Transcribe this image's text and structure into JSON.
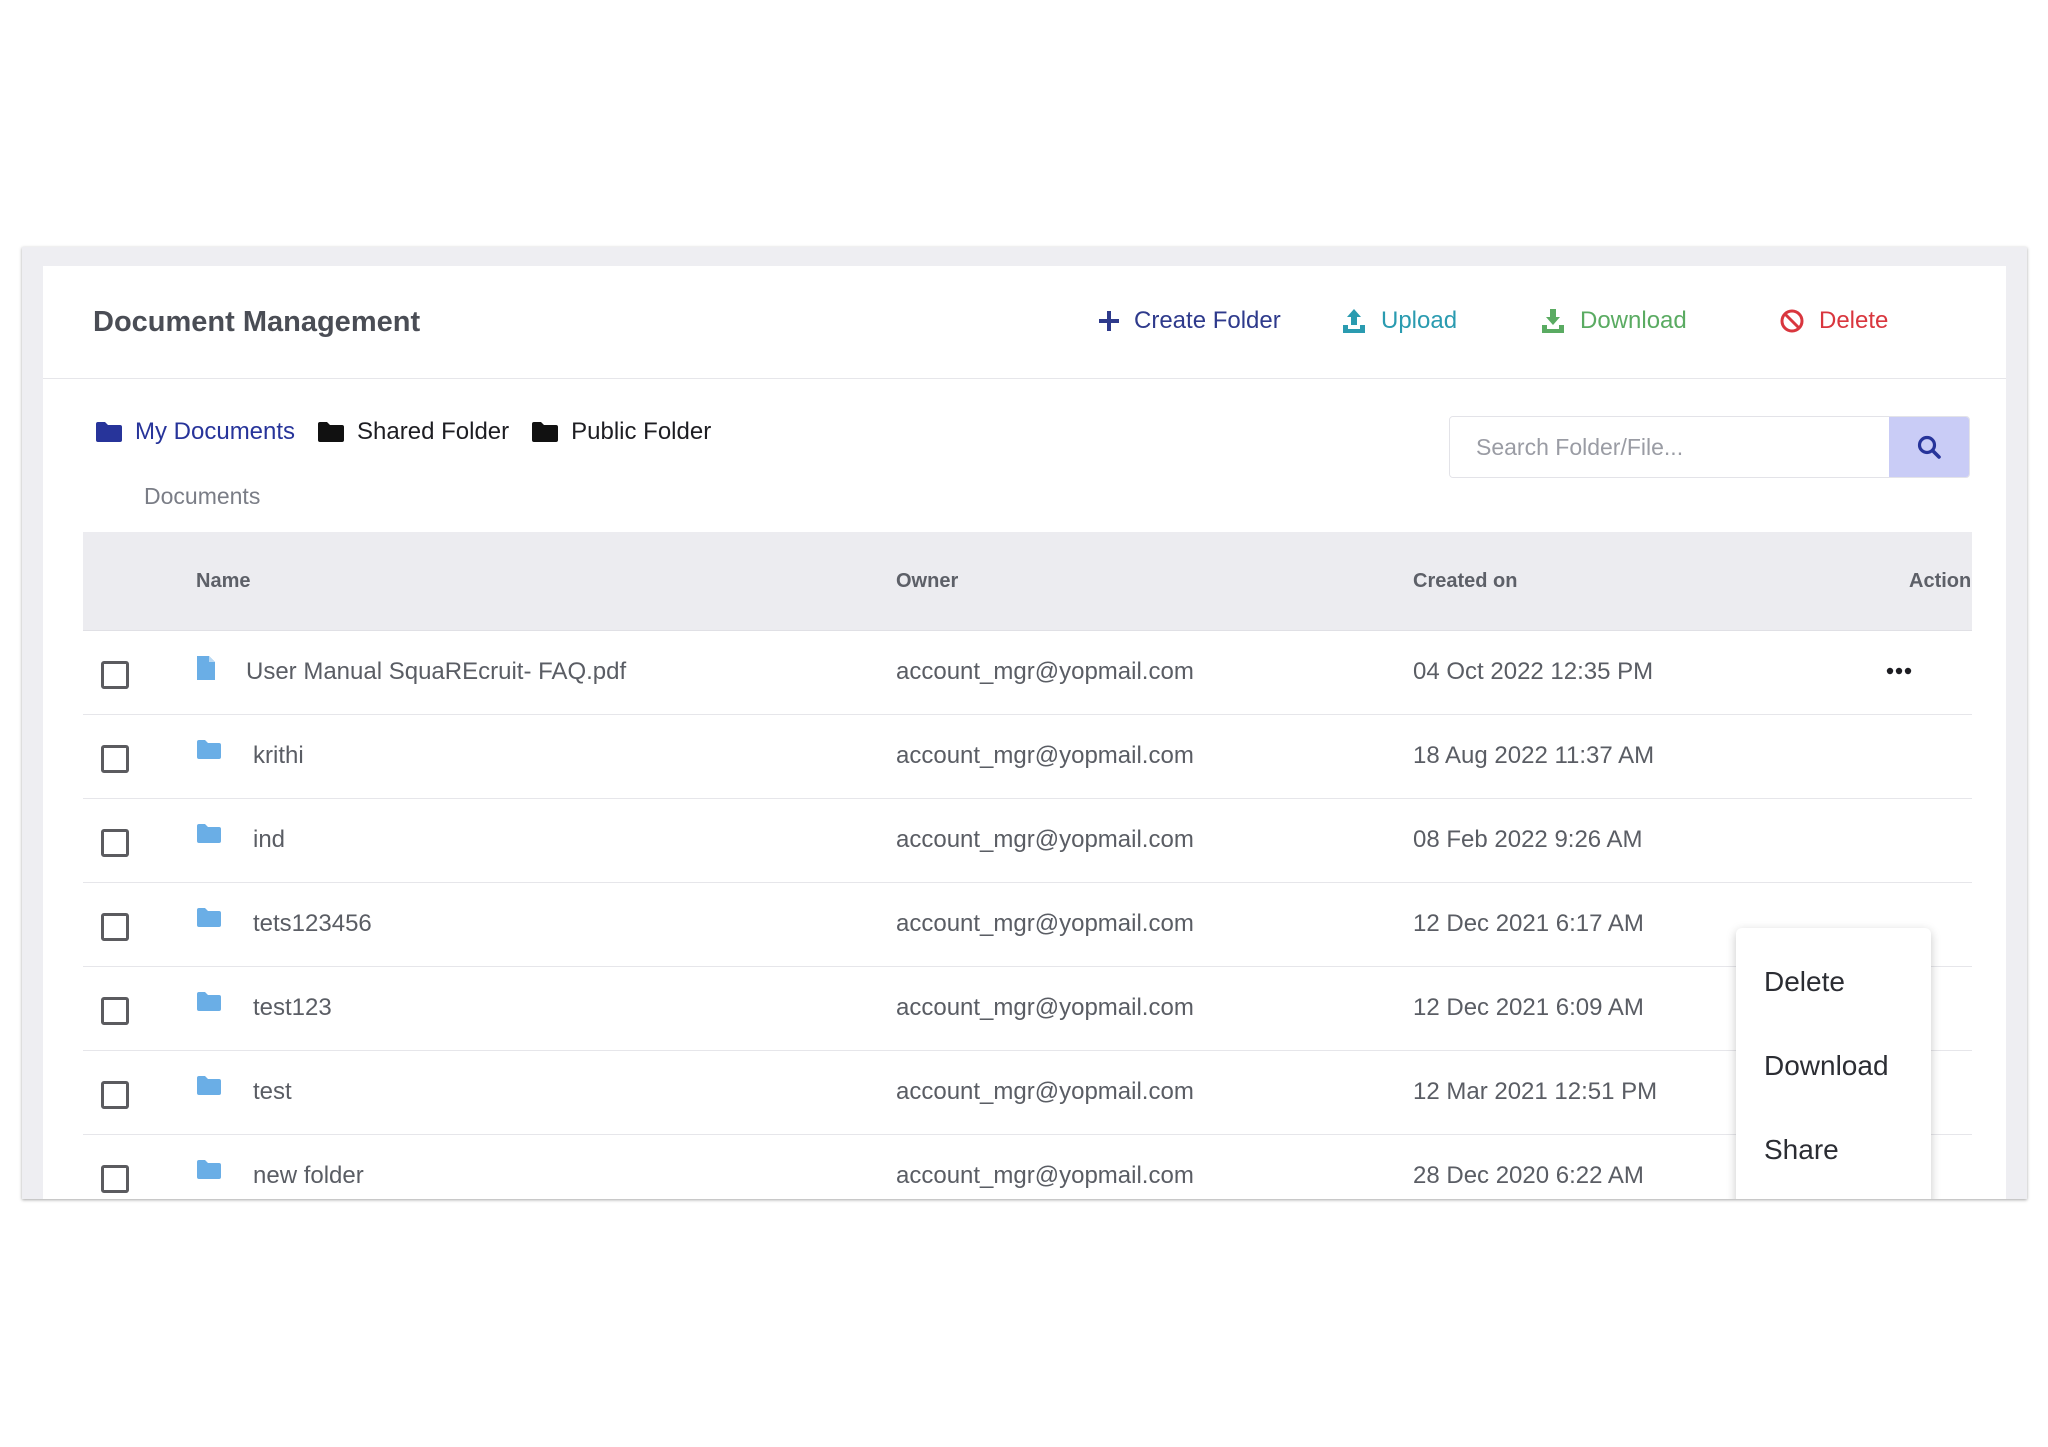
{
  "header": {
    "title": "Document Management",
    "actions": {
      "create_folder": "Create Folder",
      "upload": "Upload",
      "download": "Download",
      "delete": "Delete"
    }
  },
  "nav": {
    "my_documents": "My Documents",
    "shared_folder": "Shared Folder",
    "public_folder": "Public Folder"
  },
  "breadcrumb": "Documents",
  "search": {
    "placeholder": "Search Folder/File..."
  },
  "table": {
    "columns": {
      "name": "Name",
      "owner": "Owner",
      "created_on": "Created on",
      "action": "Action"
    },
    "rows": [
      {
        "type": "file",
        "name": "User Manual SquaREcruit- FAQ.pdf",
        "owner": "account_mgr@yopmail.com",
        "created_on": "04 Oct 2022 12:35 PM"
      },
      {
        "type": "folder",
        "name": "krithi",
        "owner": "account_mgr@yopmail.com",
        "created_on": "18 Aug 2022 11:37 AM"
      },
      {
        "type": "folder",
        "name": "ind",
        "owner": "account_mgr@yopmail.com",
        "created_on": "08 Feb 2022 9:26 AM"
      },
      {
        "type": "folder",
        "name": "tets123456",
        "owner": "account_mgr@yopmail.com",
        "created_on": "12 Dec 2021 6:17 AM"
      },
      {
        "type": "folder",
        "name": "test123",
        "owner": "account_mgr@yopmail.com",
        "created_on": "12 Dec 2021 6:09 AM"
      },
      {
        "type": "folder",
        "name": "test",
        "owner": "account_mgr@yopmail.com",
        "created_on": "12 Mar 2021 12:51 PM"
      },
      {
        "type": "folder",
        "name": "new folder",
        "owner": "account_mgr@yopmail.com",
        "created_on": "28 Dec 2020 6:22 AM"
      }
    ]
  },
  "context_menu": {
    "delete": "Delete",
    "download": "Download",
    "share": "Share"
  },
  "colors": {
    "primary": "#27349a",
    "upload": "#2a9bb0",
    "download": "#5aab62",
    "delete": "#d9363e",
    "folder_icon": "#6aaee6",
    "search_button": "#c9ccf6"
  }
}
